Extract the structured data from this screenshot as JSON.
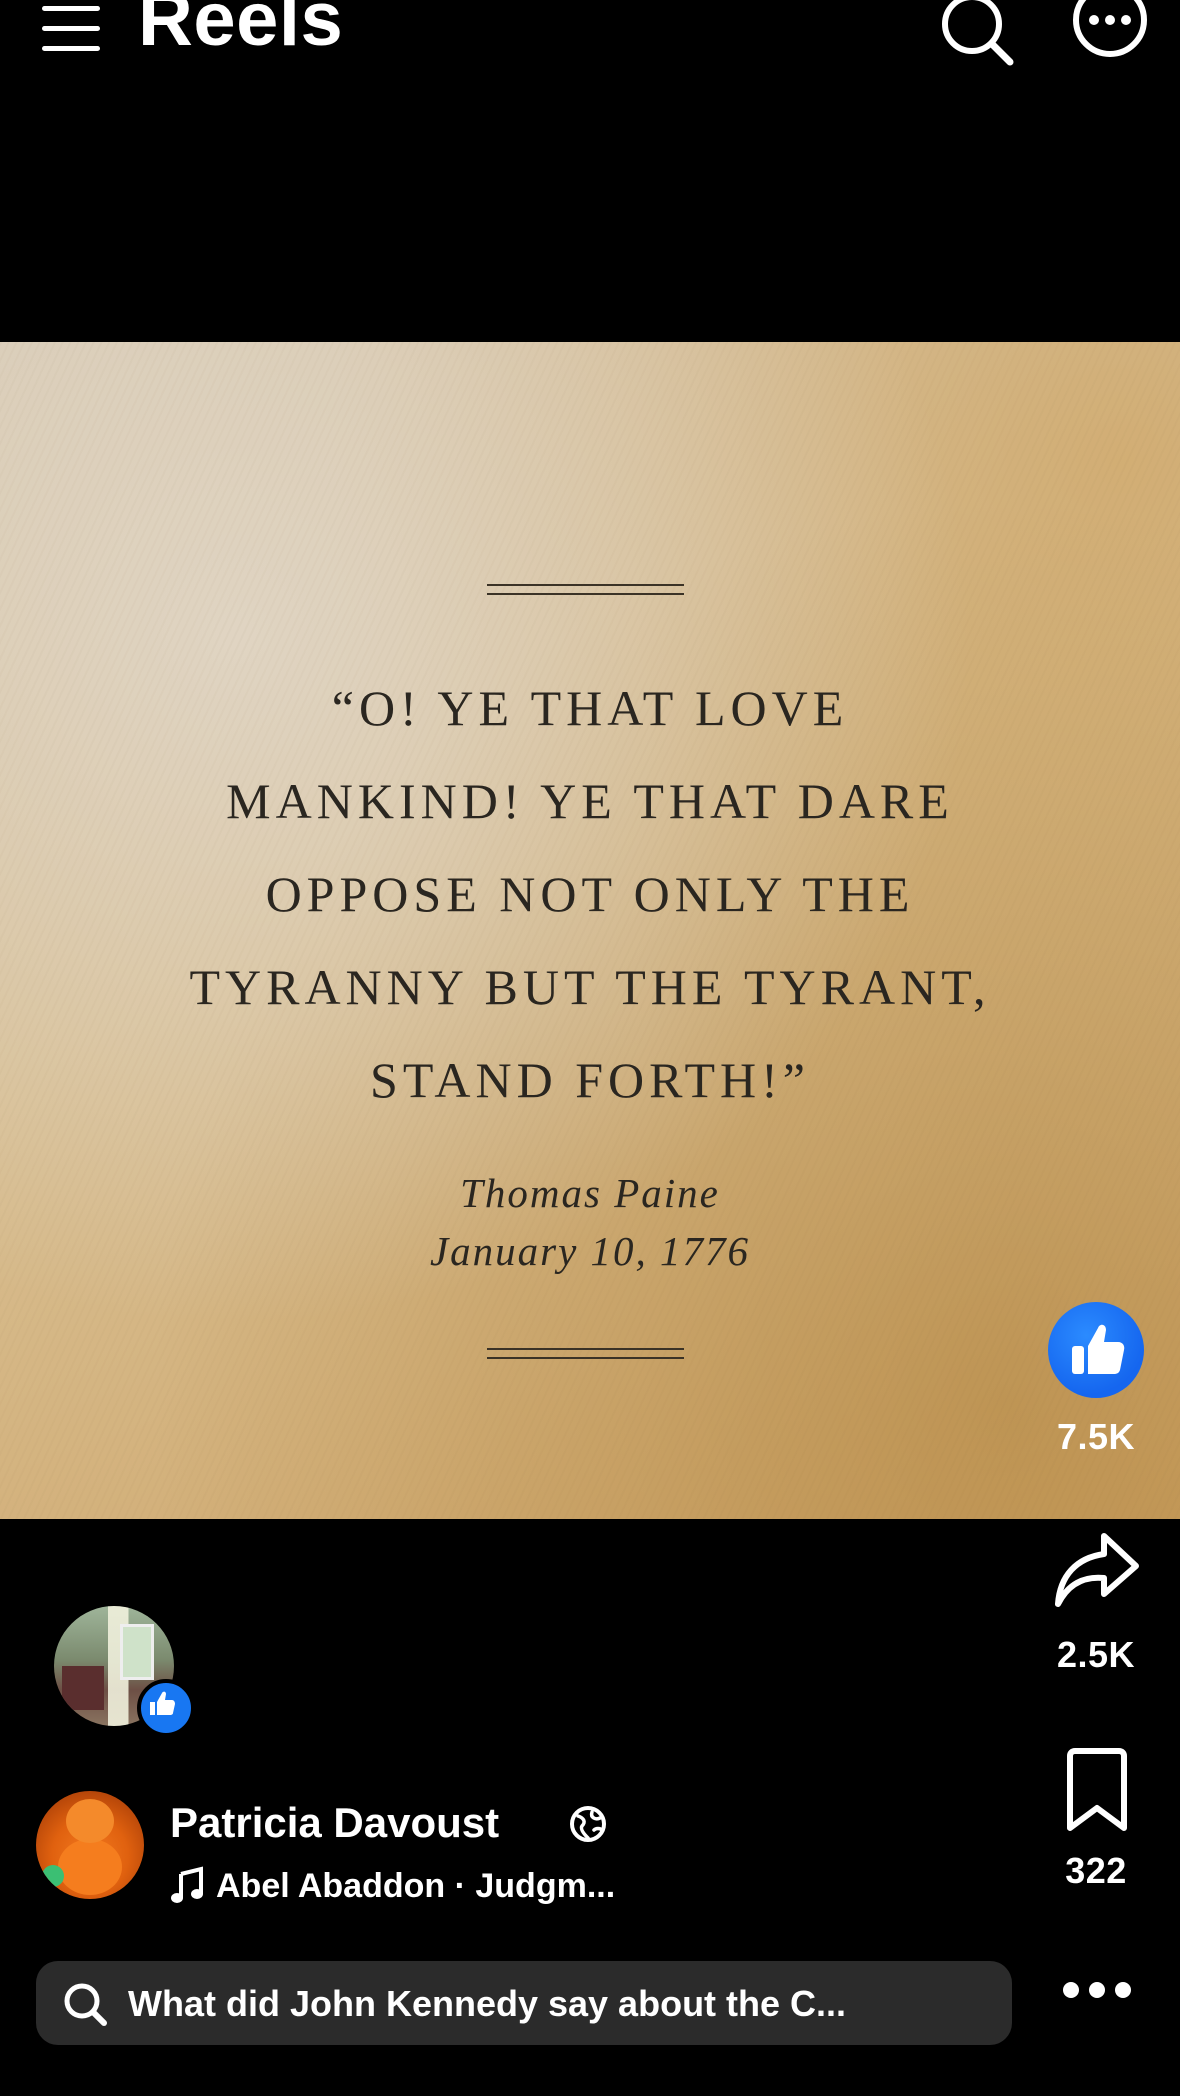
{
  "header": {
    "title": "Reels",
    "icons": [
      "menu-icon",
      "search-icon",
      "more-circle-icon"
    ]
  },
  "post": {
    "quote_lines": [
      "“O! YE THAT LOVE",
      "MANKIND! YE THAT DARE",
      "OPPOSE NOT ONLY THE",
      "TYRANNY BUT THE TYRANT,",
      "STAND FORTH!”"
    ],
    "attribution": {
      "name": "Thomas Paine",
      "date": "January 10, 1776"
    }
  },
  "actions": {
    "like_count": "7.5K",
    "share_count": "2.5K",
    "save_count": "322"
  },
  "author": {
    "name": "Patricia Davoust",
    "audio": "Abel Abaddon · Judgm..."
  },
  "search": {
    "query": "What did John Kennedy say about the C..."
  },
  "colors": {
    "background": "#000000",
    "like_blue": "#1877f2",
    "search_bar": "#2b2b2b",
    "card_ink": "#2a2620"
  }
}
